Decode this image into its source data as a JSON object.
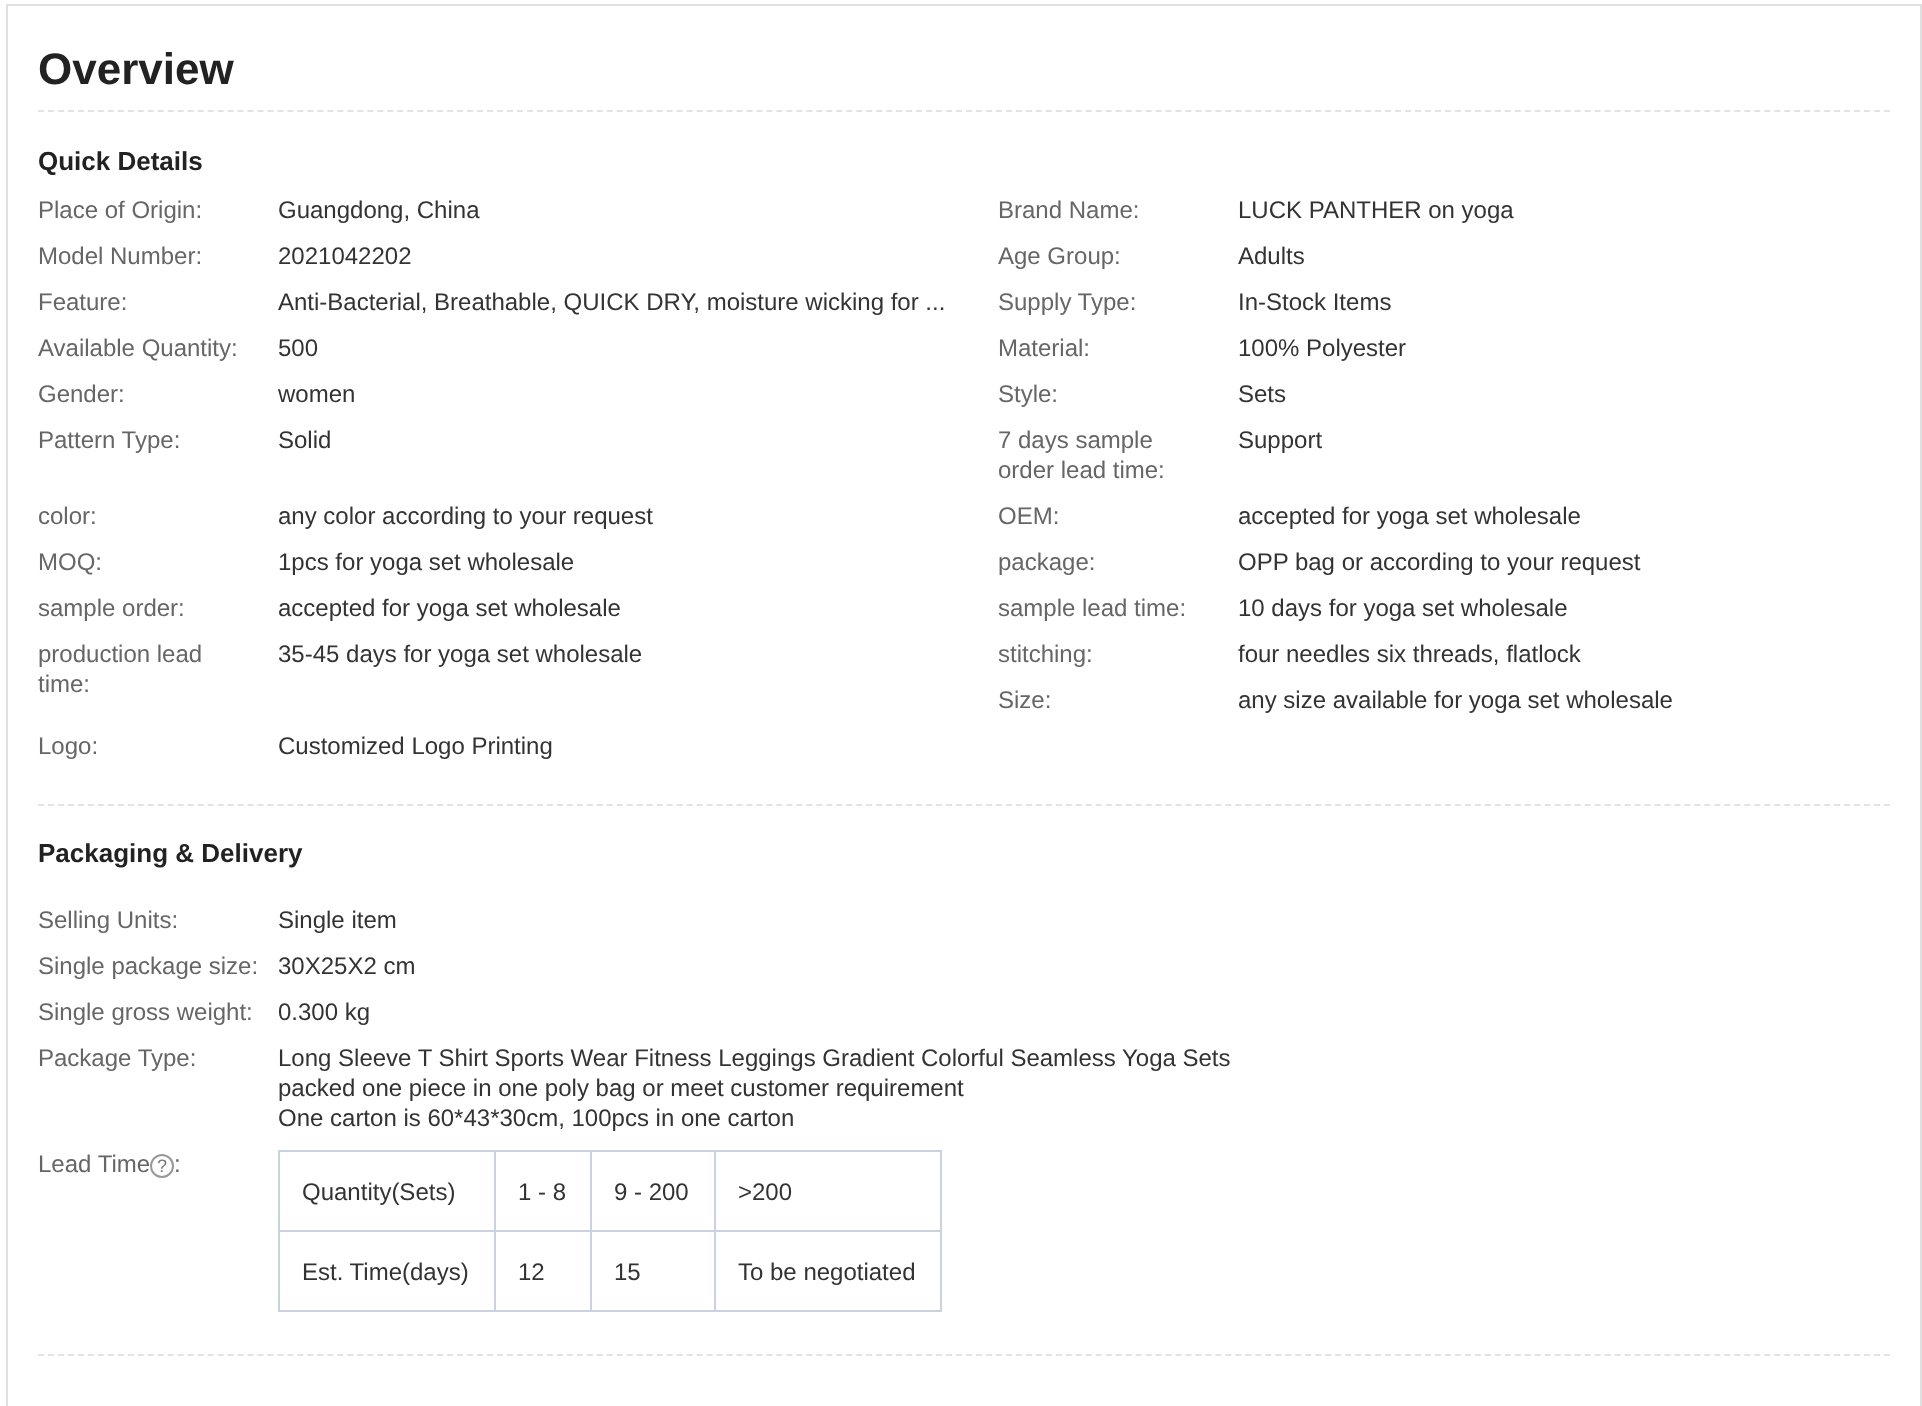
{
  "title": "Overview",
  "quick_details": {
    "heading": "Quick Details",
    "rows": [
      {
        "left": {
          "label": "Place of Origin:",
          "value": "Guangdong, China"
        },
        "right": {
          "label": "Brand Name:",
          "value": "LUCK PANTHER on yoga"
        }
      },
      {
        "left": {
          "label": "Model Number:",
          "value": "2021042202"
        },
        "right": {
          "label": "Age Group:",
          "value": "Adults"
        }
      },
      {
        "left": {
          "label": "Feature:",
          "value": "Anti-Bacterial, Breathable, QUICK DRY, moisture wicking for ..."
        },
        "right": {
          "label": "Supply Type:",
          "value": "In-Stock Items"
        }
      },
      {
        "left": {
          "label": "Available Quantity:",
          "value": "500"
        },
        "right": {
          "label": "Material:",
          "value": "100% Polyester"
        }
      },
      {
        "left": {
          "label": "Gender:",
          "value": "women"
        },
        "right": {
          "label": "Style:",
          "value": "Sets"
        }
      },
      {
        "left": {
          "label": "Pattern Type:",
          "value": "Solid"
        },
        "right": {
          "label": "7 days sample order lead time:",
          "value": "Support"
        }
      },
      {
        "left": {
          "label": "color:",
          "value": "any color according to your request"
        },
        "right": {
          "label": "OEM:",
          "value": "accepted for yoga set wholesale"
        }
      },
      {
        "left": {
          "label": "MOQ:",
          "value": "1pcs for yoga set wholesale"
        },
        "right": {
          "label": "package:",
          "value": "OPP bag or according to your request"
        }
      },
      {
        "left": {
          "label": "sample order:",
          "value": "accepted for yoga set wholesale"
        },
        "right": {
          "label": "sample lead time:",
          "value": "10 days for yoga set wholesale"
        }
      },
      {
        "left": {
          "label": "production lead time:",
          "value": "35-45 days for yoga set wholesale"
        },
        "right": {
          "label": "stitching:",
          "value": "four needles six threads, flatlock"
        },
        "right_extra": {
          "label": "Size:",
          "value": "any size available for yoga set wholesale"
        }
      },
      {
        "left": {
          "label": "Logo:",
          "value": "Customized Logo Printing"
        }
      }
    ]
  },
  "packaging": {
    "heading": "Packaging & Delivery",
    "rows": [
      {
        "label": "Selling Units:",
        "lines": [
          "Single item"
        ]
      },
      {
        "label": "Single package size:",
        "lines": [
          "30X25X2 cm"
        ]
      },
      {
        "label": "Single gross weight:",
        "lines": [
          "0.300 kg"
        ]
      },
      {
        "label": "Package Type:",
        "lines": [
          "Long Sleeve T Shirt Sports Wear Fitness Leggings Gradient Colorful Seamless Yoga Sets",
          "packed one piece in one poly bag or meet customer requirement",
          "One carton is 60*43*30cm, 100pcs in one carton"
        ]
      }
    ],
    "lead_time": {
      "label": "Lead Time",
      "suffix": ":",
      "help": "?",
      "table": [
        [
          "Quantity(Sets)",
          "1 - 8",
          "9 - 200",
          ">200"
        ],
        [
          "Est. Time(days)",
          "12",
          "15",
          "To be negotiated"
        ]
      ]
    }
  }
}
